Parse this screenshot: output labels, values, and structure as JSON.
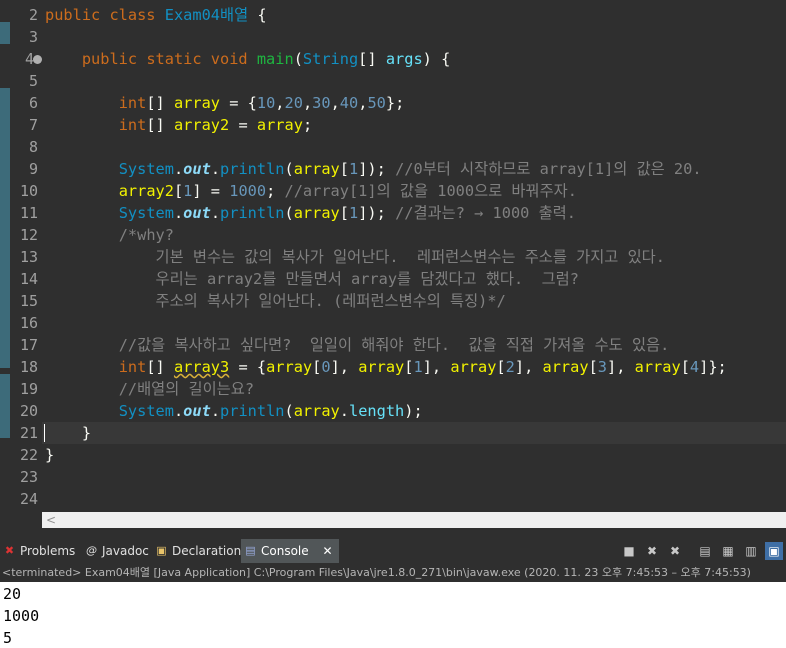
{
  "editor": {
    "lines": [
      {
        "n": "2",
        "segs": [
          [
            "kw",
            "public "
          ],
          [
            "kw",
            "class "
          ],
          [
            "cls",
            "Exam04배열"
          ],
          [
            "plain",
            " {"
          ]
        ]
      },
      {
        "n": "3",
        "segs": []
      },
      {
        "n": "4",
        "segs": [
          [
            "plain",
            "    "
          ],
          [
            "kw",
            "public "
          ],
          [
            "kw",
            "static "
          ],
          [
            "kw",
            "void "
          ],
          [
            "mth",
            "main"
          ],
          [
            "plain",
            "("
          ],
          [
            "cls",
            "String"
          ],
          [
            "plain",
            "[] "
          ],
          [
            "fld",
            "args"
          ],
          [
            "plain",
            ") {"
          ]
        ],
        "fold": true
      },
      {
        "n": "5",
        "segs": []
      },
      {
        "n": "6",
        "segs": [
          [
            "plain",
            "        "
          ],
          [
            "kw",
            "int"
          ],
          [
            "plain",
            "[] "
          ],
          [
            "var",
            "array"
          ],
          [
            "plain",
            " = {"
          ],
          [
            "num",
            "10"
          ],
          [
            "plain",
            ","
          ],
          [
            "num",
            "20"
          ],
          [
            "plain",
            ","
          ],
          [
            "num",
            "30"
          ],
          [
            "plain",
            ","
          ],
          [
            "num",
            "40"
          ],
          [
            "plain",
            ","
          ],
          [
            "num",
            "50"
          ],
          [
            "plain",
            "};"
          ]
        ]
      },
      {
        "n": "7",
        "segs": [
          [
            "plain",
            "        "
          ],
          [
            "kw",
            "int"
          ],
          [
            "plain",
            "[] "
          ],
          [
            "var",
            "array2"
          ],
          [
            "plain",
            " = "
          ],
          [
            "var",
            "array"
          ],
          [
            "plain",
            ";"
          ]
        ]
      },
      {
        "n": "8",
        "segs": []
      },
      {
        "n": "9",
        "segs": [
          [
            "plain",
            "        "
          ],
          [
            "cls",
            "System"
          ],
          [
            "plain",
            "."
          ],
          [
            "sfld",
            "out"
          ],
          [
            "plain",
            "."
          ],
          [
            "cls",
            "println"
          ],
          [
            "plain",
            "("
          ],
          [
            "var",
            "array"
          ],
          [
            "plain",
            "["
          ],
          [
            "num",
            "1"
          ],
          [
            "plain",
            "]); "
          ],
          [
            "cmt",
            "//0부터 시작하므로 array[1]의 값은 20."
          ]
        ]
      },
      {
        "n": "10",
        "segs": [
          [
            "plain",
            "        "
          ],
          [
            "var",
            "array2"
          ],
          [
            "plain",
            "["
          ],
          [
            "num",
            "1"
          ],
          [
            "plain",
            "] = "
          ],
          [
            "num",
            "1000"
          ],
          [
            "plain",
            "; "
          ],
          [
            "cmt",
            "//array[1]의 값을 1000으로 바꿔주자."
          ]
        ]
      },
      {
        "n": "11",
        "segs": [
          [
            "plain",
            "        "
          ],
          [
            "cls",
            "System"
          ],
          [
            "plain",
            "."
          ],
          [
            "sfld",
            "out"
          ],
          [
            "plain",
            "."
          ],
          [
            "cls",
            "println"
          ],
          [
            "plain",
            "("
          ],
          [
            "var",
            "array"
          ],
          [
            "plain",
            "["
          ],
          [
            "num",
            "1"
          ],
          [
            "plain",
            "]); "
          ],
          [
            "cmt",
            "//결과는? → 1000 출력."
          ]
        ]
      },
      {
        "n": "12",
        "segs": [
          [
            "plain",
            "        "
          ],
          [
            "cmt",
            "/*why?"
          ]
        ]
      },
      {
        "n": "13",
        "segs": [
          [
            "cmt",
            "            기본 변수는 값의 복사가 일어난다.  레퍼런스변수는 주소를 가지고 있다."
          ]
        ]
      },
      {
        "n": "14",
        "segs": [
          [
            "cmt",
            "            우리는 array2를 만들면서 array를 담겠다고 했다.  그럼?"
          ]
        ]
      },
      {
        "n": "15",
        "segs": [
          [
            "cmt",
            "            주소의 복사가 일어난다. (레퍼런스변수의 특징)*/"
          ]
        ]
      },
      {
        "n": "16",
        "segs": []
      },
      {
        "n": "17",
        "segs": [
          [
            "plain",
            "        "
          ],
          [
            "cmt",
            "//값을 복사하고 싶다면?  일일이 해줘야 한다.  값을 직접 가져올 수도 있음."
          ]
        ]
      },
      {
        "n": "18",
        "segs": [
          [
            "plain",
            "        "
          ],
          [
            "kw",
            "int"
          ],
          [
            "plain",
            "[] "
          ],
          [
            "warnvar",
            "array3"
          ],
          [
            "plain",
            " = {"
          ],
          [
            "var",
            "array"
          ],
          [
            "plain",
            "["
          ],
          [
            "num",
            "0"
          ],
          [
            "plain",
            "], "
          ],
          [
            "var",
            "array"
          ],
          [
            "plain",
            "["
          ],
          [
            "num",
            "1"
          ],
          [
            "plain",
            "], "
          ],
          [
            "var",
            "array"
          ],
          [
            "plain",
            "["
          ],
          [
            "num",
            "2"
          ],
          [
            "plain",
            "], "
          ],
          [
            "var",
            "array"
          ],
          [
            "plain",
            "["
          ],
          [
            "num",
            "3"
          ],
          [
            "plain",
            "], "
          ],
          [
            "var",
            "array"
          ],
          [
            "plain",
            "["
          ],
          [
            "num",
            "4"
          ],
          [
            "plain",
            "]};"
          ]
        ],
        "warn": true
      },
      {
        "n": "19",
        "segs": [
          [
            "plain",
            "        "
          ],
          [
            "cmt",
            "//배열의 길이는요?"
          ]
        ]
      },
      {
        "n": "20",
        "segs": [
          [
            "plain",
            "        "
          ],
          [
            "cls",
            "System"
          ],
          [
            "plain",
            "."
          ],
          [
            "sfld",
            "out"
          ],
          [
            "plain",
            "."
          ],
          [
            "cls",
            "println"
          ],
          [
            "plain",
            "("
          ],
          [
            "var",
            "array"
          ],
          [
            "plain",
            "."
          ],
          [
            "fld",
            "length"
          ],
          [
            "plain",
            ");"
          ]
        ]
      },
      {
        "n": "21",
        "segs": [
          [
            "plain",
            "    }"
          ]
        ],
        "current": true
      },
      {
        "n": "22",
        "segs": [
          [
            "plain",
            "}"
          ]
        ]
      },
      {
        "n": "23",
        "segs": []
      },
      {
        "n": "24",
        "segs": []
      }
    ],
    "scroll_arrow": "<"
  },
  "tabs": {
    "problems": "Problems",
    "javadoc": "Javadoc",
    "declaration": "Declaration",
    "console": "Console",
    "close": "✕"
  },
  "icons": {
    "problems": "problems-icon",
    "javadoc": "javadoc-icon",
    "declaration": "declaration-icon",
    "console": "console-icon"
  },
  "console": {
    "status": "<terminated> Exam04배열 [Java Application] C:\\Program Files\\Java\\jre1.8.0_271\\bin\\javaw.exe  (2020. 11. 23 오후 7:45:53 – 오후 7:45:53)",
    "output": [
      "20",
      "1000",
      "5"
    ]
  },
  "colors": {
    "keyword": "#cc6c1d",
    "class": "#1290c3",
    "method": "#1eb540",
    "variable": "#f2f200",
    "comment": "#808080",
    "number": "#6897bb",
    "background": "#2f2f2f"
  }
}
